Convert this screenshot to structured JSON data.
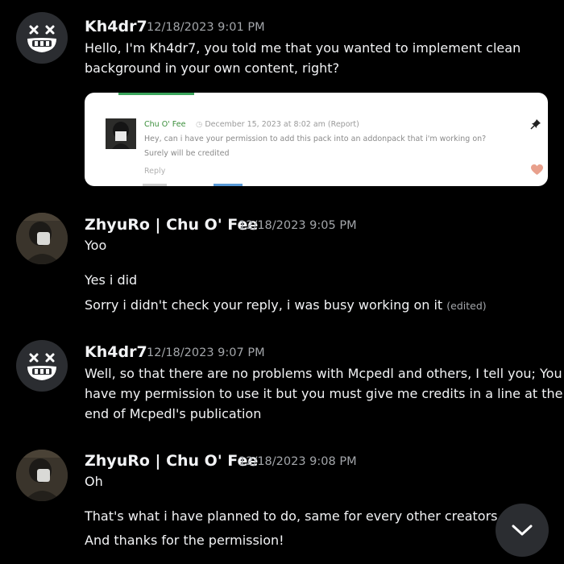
{
  "messages": [
    {
      "author": "Kh4dr7",
      "timestamp": "12/18/2023 9:01 PM",
      "lines": [
        "Hello, I'm Kh4dr7, you told me that you wanted to implement clean",
        "background in your own content, right?"
      ]
    },
    {
      "author": "ZhyuRo | Chu O' Fee",
      "timestamp": "12/18/2023 9:05 PM",
      "lines": [
        "Yoo",
        "Yes i did",
        "Sorry i didn't check your reply, i was busy working on it"
      ],
      "edited": "(edited)"
    },
    {
      "author": "Kh4dr7",
      "timestamp": "12/18/2023 9:07 PM",
      "lines": [
        "Well, so that there are no problems with Mcpedl and others, I tell you; You",
        "have my permission to use it but you must give me credits in a line at the",
        "end of Mcpedl's publication"
      ]
    },
    {
      "author": "ZhyuRo | Chu O' Fee",
      "timestamp": "12/18/2023 9:08 PM",
      "lines": [
        "Oh",
        "That's what i have planned to do, same for every other creators",
        "And thanks for the permission!"
      ]
    }
  ],
  "embed": {
    "author": "Chu O' Fee",
    "date": "December 15, 2023 at 8:02 am (Report)",
    "lines": [
      "Hey, can i have your permission to add this pack into an addonpack that i'm working on?",
      "Surely will be credited"
    ],
    "reply": "Reply"
  },
  "colors": {
    "background": "#000000",
    "text": "#f2f3f5",
    "muted": "#a3a6aa",
    "embed_green": "#3ba55c"
  },
  "icons": [
    "kh4dr7-avatar-face",
    "pin-icon",
    "heart-icon",
    "chevron-down-icon"
  ]
}
